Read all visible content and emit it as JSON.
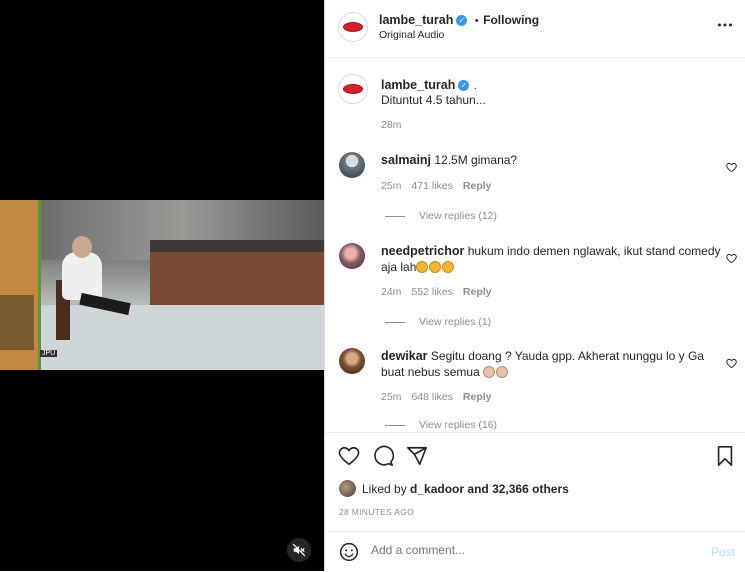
{
  "post": {
    "username": "lambe_turah",
    "follow_separator": "•",
    "follow_status": "Following",
    "audio_label": "Original Audio",
    "more_icon": "more-horizontal-icon",
    "caption_text": "Dituntut 4.5 tahun...",
    "caption_dot": ".",
    "caption_time": "28m",
    "liked_by_prefix": "Liked by",
    "liked_by_user": "d_kadoor",
    "liked_by_suffix": "and 32,366 others",
    "posted_ago": "28 MINUTES AGO"
  },
  "video": {
    "overlay_label": "JPU",
    "mute_icon": "volume-muted-icon"
  },
  "comments": [
    {
      "username": "salmainj",
      "text": "12.5M gimana?",
      "time": "25m",
      "likes": "471 likes",
      "reply": "Reply",
      "view_replies": "View replies (12)"
    },
    {
      "username": "needpetrichor",
      "text": "hukum indo demen nglawak, ikut stand comedy aja lah",
      "time": "24m",
      "likes": "552 likes",
      "reply": "Reply",
      "view_replies": "View replies (1)"
    },
    {
      "username": "dewikar",
      "text": "Segitu doang ? Yauda gpp. Akherat nunggu lo y Ga buat nebus semua",
      "time": "25m",
      "likes": "648 likes",
      "reply": "Reply",
      "view_replies": "View replies (16)"
    }
  ],
  "comment_bar": {
    "placeholder": "Add a comment...",
    "post_label": "Post",
    "emoji_icon": "smiley-icon"
  },
  "colors": {
    "verified": "#3897f0",
    "brand_red": "#d4202b",
    "post_button_disabled": "#b2dffc",
    "muted_text": "#8e8e8e"
  }
}
